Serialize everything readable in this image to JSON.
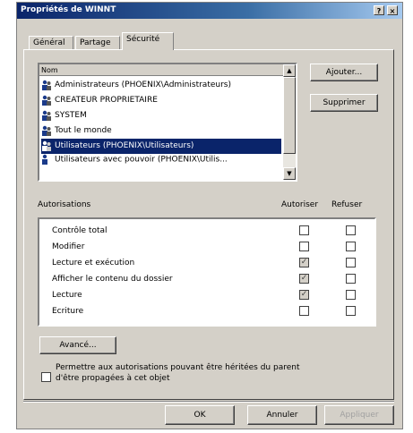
{
  "window": {
    "title": "Propriétés de WINNT",
    "help_label": "?",
    "close_label": "×"
  },
  "tabs": [
    {
      "label": "Général",
      "active": false
    },
    {
      "label": "Partage",
      "active": false
    },
    {
      "label": "Sécurité",
      "active": true
    }
  ],
  "names": {
    "header": "Nom",
    "items": [
      {
        "label": "Administrateurs (PHOENIX\\Administrateurs)",
        "icon": "users-icon",
        "selected": false
      },
      {
        "label": "CREATEUR PROPRIETAIRE",
        "icon": "users-icon",
        "selected": false
      },
      {
        "label": "SYSTEM",
        "icon": "users-icon",
        "selected": false
      },
      {
        "label": "Tout le monde",
        "icon": "users-icon",
        "selected": false
      },
      {
        "label": "Utilisateurs (PHOENIX\\Utilisateurs)",
        "icon": "users-icon",
        "selected": true
      }
    ],
    "partial_item": "Utilisateurs avec pouvoir (PHOENIX\\Utilis..."
  },
  "buttons": {
    "add": "Ajouter...",
    "remove": "Supprimer",
    "advanced": "Avancé...",
    "ok": "OK",
    "cancel": "Annuler",
    "apply": "Appliquer"
  },
  "permissions": {
    "label": "Autorisations",
    "allow_header": "Autoriser",
    "deny_header": "Refuser",
    "rows": [
      {
        "name": "Contrôle total",
        "allow": false,
        "deny": false
      },
      {
        "name": "Modifier",
        "allow": false,
        "deny": false
      },
      {
        "name": "Lecture et exécution",
        "allow": true,
        "deny": false
      },
      {
        "name": "Afficher le contenu du dossier",
        "allow": true,
        "deny": false
      },
      {
        "name": "Lecture",
        "allow": true,
        "deny": false
      },
      {
        "name": "Ecriture",
        "allow": false,
        "deny": false
      }
    ]
  },
  "inherit": {
    "line1": "Permettre aux autorisations pouvant être héritées du parent",
    "line2": "d'être propagées à cet objet",
    "checked": false
  },
  "colors": {
    "selection": "#0a246a",
    "face": "#d4d0c8",
    "title_start": "#0a246a",
    "title_end": "#a6caf0"
  }
}
